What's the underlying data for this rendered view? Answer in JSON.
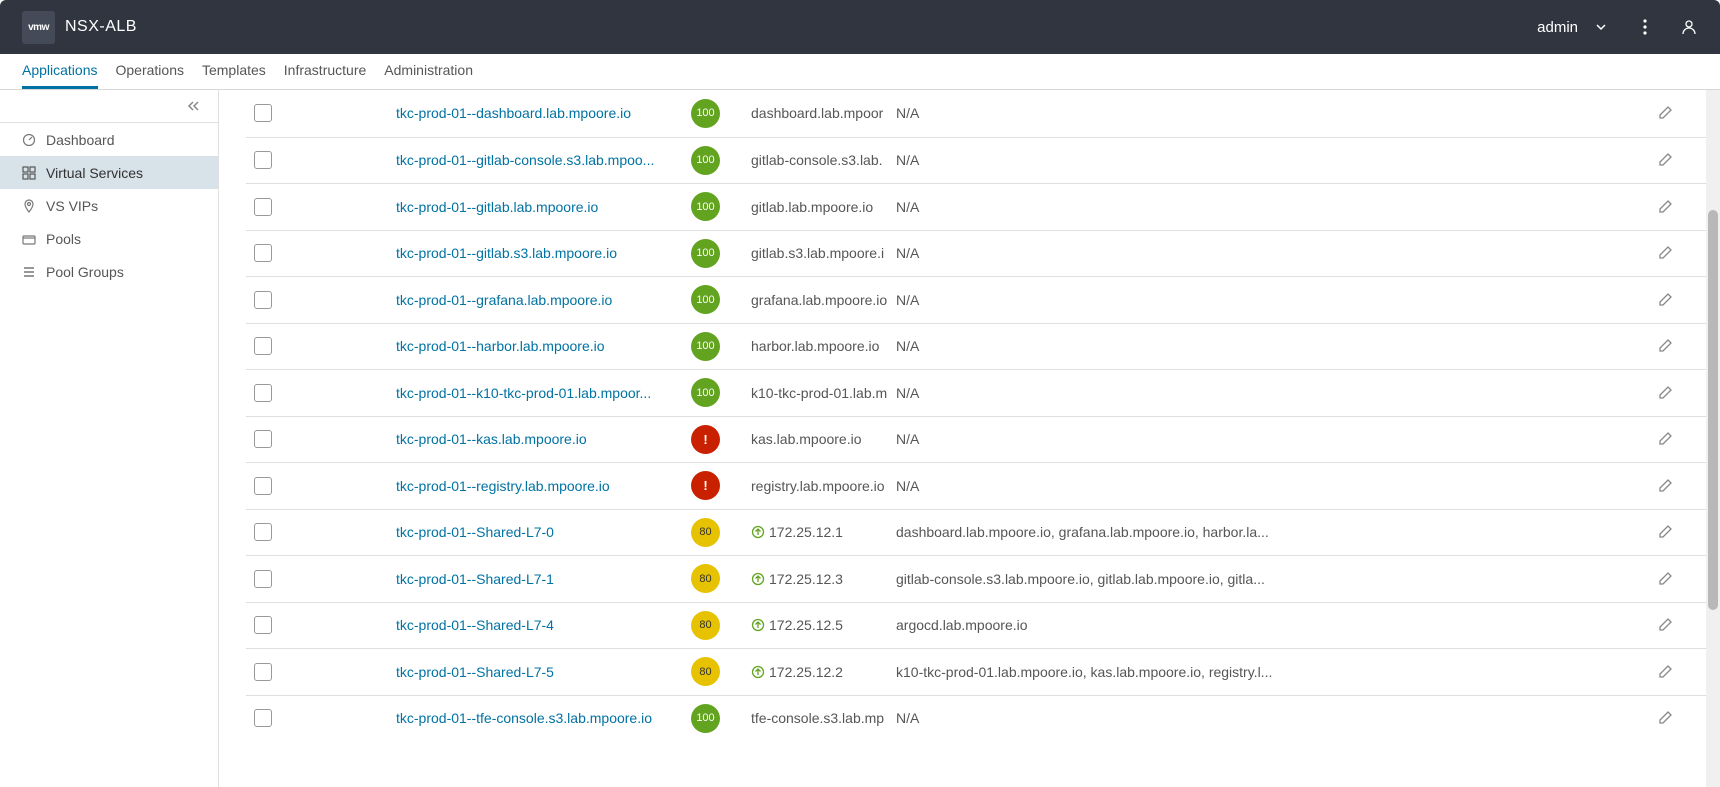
{
  "product": "NSX-ALB",
  "logo_text": "vmw",
  "user": "admin",
  "nav_tabs": [
    "Applications",
    "Operations",
    "Templates",
    "Infrastructure",
    "Administration"
  ],
  "nav_active_index": 0,
  "sidebar": {
    "items": [
      {
        "label": "Dashboard",
        "icon": "dashboard-icon"
      },
      {
        "label": "Virtual Services",
        "icon": "grid-icon"
      },
      {
        "label": "VS VIPs",
        "icon": "pin-icon"
      },
      {
        "label": "Pools",
        "icon": "folder-icon"
      },
      {
        "label": "Pool Groups",
        "icon": "list-icon"
      }
    ],
    "active_index": 1
  },
  "rows": [
    {
      "name": "tkc-prod-01--dashboard.lab.mpoore.io",
      "health": "100",
      "health_type": "ok",
      "address": "dashboard.lab.mpoor",
      "show_vip_icon": false,
      "extra": "N/A"
    },
    {
      "name": "tkc-prod-01--gitlab-console.s3.lab.mpoo...",
      "health": "100",
      "health_type": "ok",
      "address": "gitlab-console.s3.lab.",
      "show_vip_icon": false,
      "extra": "N/A"
    },
    {
      "name": "tkc-prod-01--gitlab.lab.mpoore.io",
      "health": "100",
      "health_type": "ok",
      "address": "gitlab.lab.mpoore.io",
      "show_vip_icon": false,
      "extra": "N/A"
    },
    {
      "name": "tkc-prod-01--gitlab.s3.lab.mpoore.io",
      "health": "100",
      "health_type": "ok",
      "address": "gitlab.s3.lab.mpoore.i",
      "show_vip_icon": false,
      "extra": "N/A"
    },
    {
      "name": "tkc-prod-01--grafana.lab.mpoore.io",
      "health": "100",
      "health_type": "ok",
      "address": "grafana.lab.mpoore.io",
      "show_vip_icon": false,
      "extra": "N/A"
    },
    {
      "name": "tkc-prod-01--harbor.lab.mpoore.io",
      "health": "100",
      "health_type": "ok",
      "address": "harbor.lab.mpoore.io",
      "show_vip_icon": false,
      "extra": "N/A"
    },
    {
      "name": "tkc-prod-01--k10-tkc-prod-01.lab.mpoor...",
      "health": "100",
      "health_type": "ok",
      "address": "k10-tkc-prod-01.lab.m",
      "show_vip_icon": false,
      "extra": "N/A"
    },
    {
      "name": "tkc-prod-01--kas.lab.mpoore.io",
      "health": "!",
      "health_type": "error",
      "address": "kas.lab.mpoore.io",
      "show_vip_icon": false,
      "extra": "N/A"
    },
    {
      "name": "tkc-prod-01--registry.lab.mpoore.io",
      "health": "!",
      "health_type": "error",
      "address": "registry.lab.mpoore.io",
      "show_vip_icon": false,
      "extra": "N/A"
    },
    {
      "name": "tkc-prod-01--Shared-L7-0",
      "health": "80",
      "health_type": "warn",
      "address": "172.25.12.1",
      "show_vip_icon": true,
      "extra": "dashboard.lab.mpoore.io, grafana.lab.mpoore.io, harbor.la..."
    },
    {
      "name": "tkc-prod-01--Shared-L7-1",
      "health": "80",
      "health_type": "warn",
      "address": "172.25.12.3",
      "show_vip_icon": true,
      "extra": "gitlab-console.s3.lab.mpoore.io, gitlab.lab.mpoore.io, gitla..."
    },
    {
      "name": "tkc-prod-01--Shared-L7-4",
      "health": "80",
      "health_type": "warn",
      "address": "172.25.12.5",
      "show_vip_icon": true,
      "extra": "argocd.lab.mpoore.io"
    },
    {
      "name": "tkc-prod-01--Shared-L7-5",
      "health": "80",
      "health_type": "warn",
      "address": "172.25.12.2",
      "show_vip_icon": true,
      "extra": "k10-tkc-prod-01.lab.mpoore.io, kas.lab.mpoore.io, registry.l..."
    },
    {
      "name": "tkc-prod-01--tfe-console.s3.lab.mpoore.io",
      "health": "100",
      "health_type": "ok",
      "address": "tfe-console.s3.lab.mp",
      "show_vip_icon": false,
      "extra": "N/A"
    }
  ]
}
